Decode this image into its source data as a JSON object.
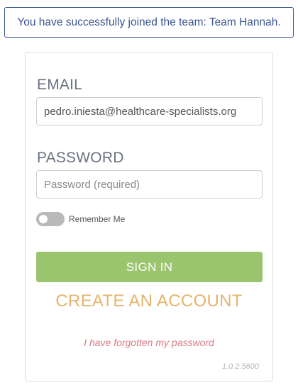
{
  "notification": {
    "message": "You have successfully joined the team: Team Hannah."
  },
  "login": {
    "email_label": "EMAIL",
    "email_value": "pedro.iniesta@healthcare-specialists.org",
    "password_label": "PASSWORD",
    "password_placeholder": "Password (required)",
    "remember_label": "Remember Me",
    "remember_checked": false,
    "signin_label": "SIGN IN",
    "create_account_label": "CREATE AN ACCOUNT",
    "forgot_label": "I have forgotten my password",
    "version": "1.0.2.5600"
  },
  "colors": {
    "notification_border": "#3a5590",
    "signin_button": "#9bc46e",
    "create_account": "#e4b56d",
    "forgot_link": "#d97a86"
  }
}
